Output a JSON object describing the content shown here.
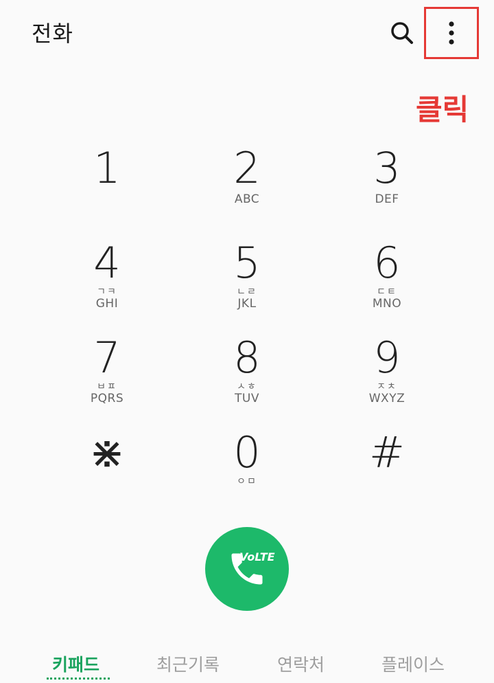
{
  "header": {
    "title": "전화",
    "search_icon": "search-icon",
    "more_icon": "more-vertical-icon"
  },
  "annotation": {
    "text": "클릭",
    "color": "#e53935"
  },
  "keypad": {
    "keys": [
      {
        "digit": "1",
        "jamo": "",
        "letters": ""
      },
      {
        "digit": "2",
        "jamo": "",
        "letters": "ABC"
      },
      {
        "digit": "3",
        "jamo": "",
        "letters": "DEF"
      },
      {
        "digit": "4",
        "jamo": "ㄱㅋ",
        "letters": "GHI"
      },
      {
        "digit": "5",
        "jamo": "ㄴㄹ",
        "letters": "JKL"
      },
      {
        "digit": "6",
        "jamo": "ㄷㅌ",
        "letters": "MNO"
      },
      {
        "digit": "7",
        "jamo": "ㅂㅍ",
        "letters": "PQRS"
      },
      {
        "digit": "8",
        "jamo": "ㅅㅎ",
        "letters": "TUV"
      },
      {
        "digit": "9",
        "jamo": "ㅈㅊ",
        "letters": "WXYZ"
      },
      {
        "digit": "⋇",
        "jamo": "",
        "letters": ""
      },
      {
        "digit": "0",
        "jamo": "ㅇㅁ",
        "letters": ""
      },
      {
        "digit": "#",
        "jamo": "",
        "letters": ""
      }
    ]
  },
  "call": {
    "badge": "VoLTE",
    "icon": "phone-icon",
    "color": "#1db96a"
  },
  "tabs": [
    {
      "label": "키패드",
      "active": true
    },
    {
      "label": "최근기록",
      "active": false
    },
    {
      "label": "연락처",
      "active": false
    },
    {
      "label": "플레이스",
      "active": false
    }
  ],
  "colors": {
    "accent": "#1aa35e",
    "background": "#fafafa"
  }
}
